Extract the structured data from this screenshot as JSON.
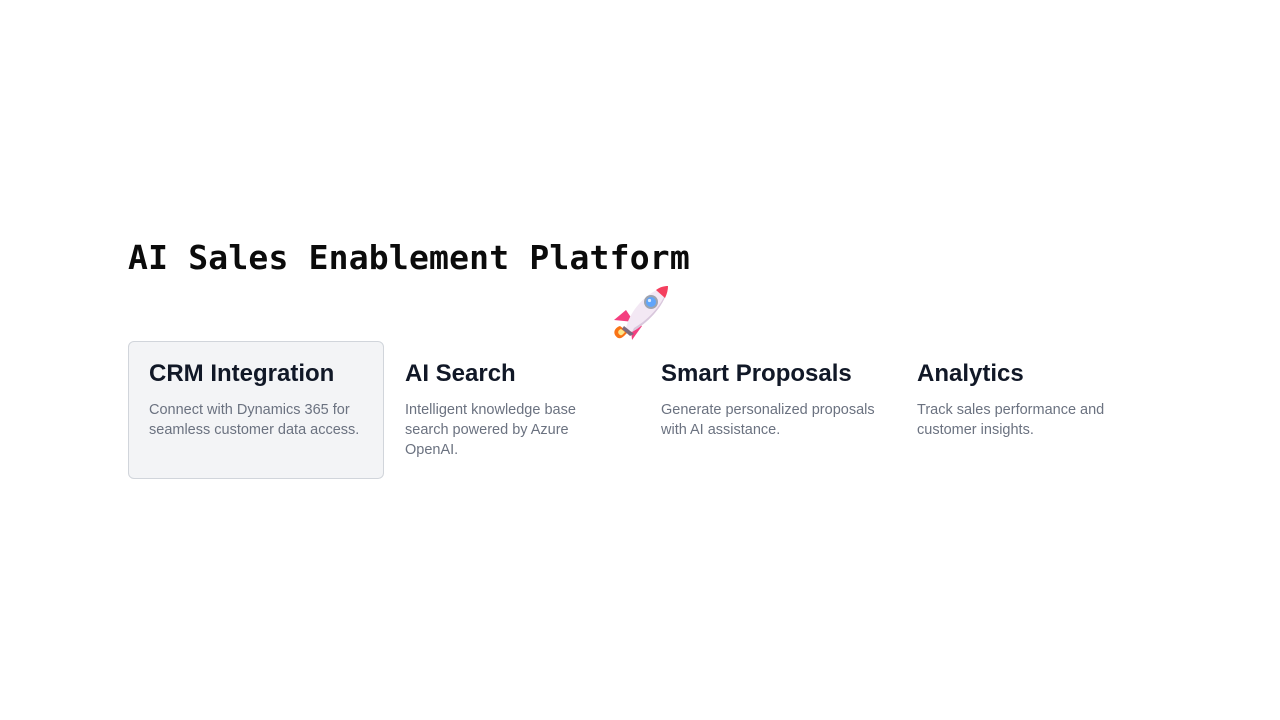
{
  "page": {
    "title": "AI Sales Enablement Platform",
    "decoration_icon": "rocket-icon"
  },
  "features": [
    {
      "title": "CRM Integration",
      "description": "Connect with Dynamics 365 for seamless customer data access.",
      "highlighted": true
    },
    {
      "title": "AI Search",
      "description": "Intelligent knowledge base search powered by Azure OpenAI.",
      "highlighted": false
    },
    {
      "title": "Smart Proposals",
      "description": "Generate personalized proposals with AI assistance.",
      "highlighted": false
    },
    {
      "title": "Analytics",
      "description": "Track sales performance and customer insights.",
      "highlighted": false
    }
  ],
  "colors": {
    "card_highlight_bg": "#f3f4f6",
    "card_highlight_border": "#d1d5db",
    "description_text": "#6b7280",
    "title_text": "#111827"
  }
}
